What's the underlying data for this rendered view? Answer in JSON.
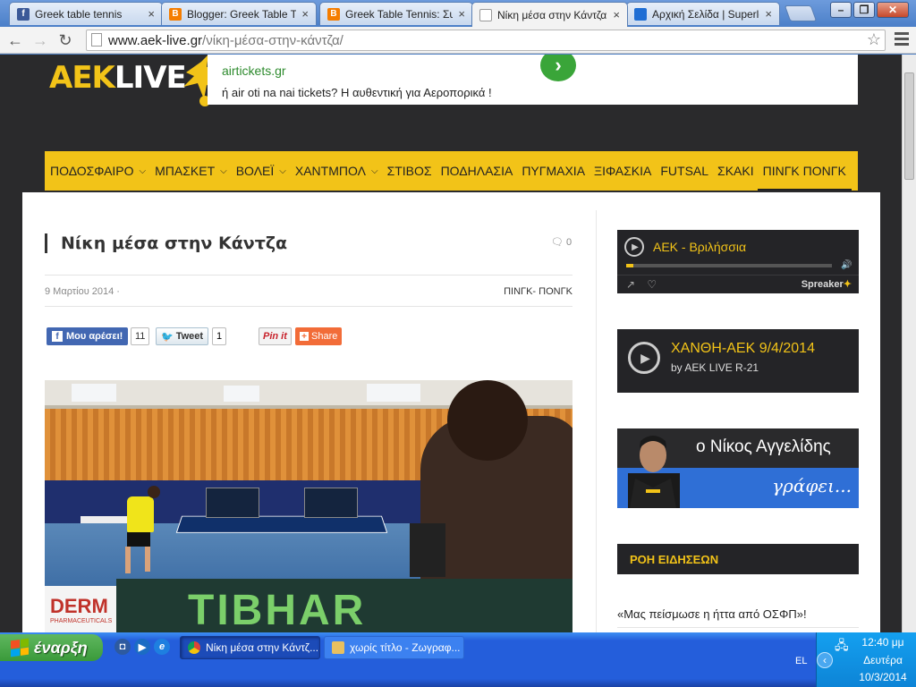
{
  "browser": {
    "tabs": [
      {
        "label": "Greek table tennis",
        "icon": "facebook-icon",
        "color": "#3b5998",
        "glyph": "f"
      },
      {
        "label": "Blogger: Greek Table Ten",
        "icon": "blogger-icon",
        "color": "#f57d00",
        "glyph": "B"
      },
      {
        "label": "Greek Table Tennis: Συνε",
        "icon": "blogger-icon",
        "color": "#f57d00",
        "glyph": "B"
      },
      {
        "label": "Νίκη μέσα στην Κάντζα",
        "icon": "page-icon",
        "color": "#ffffff",
        "glyph": ""
      },
      {
        "label": "Αρχική Σελίδα | Superlea",
        "icon": "greek-flag-icon",
        "color": "#1f6ed4",
        "glyph": ""
      }
    ],
    "active_tab": 3,
    "url_host": "www.aek-live.gr",
    "url_path": "/νίκη-μέσα-στην-κάντζα/"
  },
  "site": {
    "logo_a": "AEK",
    "logo_b": "LIVE",
    "ad_line1": "airtickets.gr",
    "ad_line2": "ή air oti na nai tickets? Η αυθεντική για Αεροπορικά !",
    "nav": [
      {
        "label": "ΠΟΔΟΣΦΑΙΡΟ",
        "dropdown": true
      },
      {
        "label": "ΜΠΑΣΚΕΤ",
        "dropdown": true
      },
      {
        "label": "ΒΟΛΕΪ",
        "dropdown": true
      },
      {
        "label": "ΧΑΝΤΜΠΟΛ",
        "dropdown": true
      },
      {
        "label": "ΣΤΙΒΟΣ",
        "dropdown": false
      },
      {
        "label": "ΠΟΔΗΛΑΣΙΑ",
        "dropdown": false
      },
      {
        "label": "ΠΥΓΜΑΧΙΑ",
        "dropdown": false
      },
      {
        "label": "ΞΙΦΑΣΚΙΑ",
        "dropdown": false
      },
      {
        "label": "FUTSAL",
        "dropdown": false
      },
      {
        "label": "ΣΚΑΚΙ",
        "dropdown": false
      },
      {
        "label": "ΠΙΝΓΚ ΠΟΝΓΚ",
        "dropdown": false,
        "current": true
      }
    ]
  },
  "article": {
    "title": "Νίκη μέσα στην Κάντζα",
    "comments": "0",
    "date": "9 Μαρτίου 2014",
    "category": "ΠΙΝΓΚ- ΠΟΝΓΚ",
    "fb_like": "Μου αρέσει!",
    "fb_count": "11",
    "tweet": "Tweet",
    "tweet_count": "1",
    "pin": "Pin it",
    "share": "Share",
    "photo_banner_left": "DERM",
    "photo_banner_left_sub": "PHARMACEUTICALS",
    "photo_banner_main": "TIBHAR"
  },
  "sidebar": {
    "player1_title": "ΑΕΚ - Βριλήσσια",
    "player1_brand": "Spreaker",
    "player2_title": "ΧΑΝΘΗ-ΑΕΚ 9/4/2014",
    "player2_sub": "by AEK LIVE R-21",
    "author_name": "ο Νίκος Αγγελίδης",
    "author_tag": "γράφει...",
    "news_head": "ΡΟΗ ΕΙΔΗΣΕΩΝ",
    "news_item": "«Μας πείσμωσε η ήττα από ΟΣΦΠ»!"
  },
  "taskbar": {
    "start": "έναρξη",
    "task1": "Νίκη μέσα στην Κάντζ...",
    "task2": "χωρίς τίτλο - Ζωγραφ...",
    "lang": "EL",
    "time": "12:40 μμ",
    "day": "Δευτέρα",
    "date": "10/3/2014"
  },
  "colors": {
    "brand_yellow": "#f2c318",
    "chrome_blue": "#4b7fc8",
    "xp_blue": "#245edb",
    "start_green": "#3a9a3a"
  }
}
